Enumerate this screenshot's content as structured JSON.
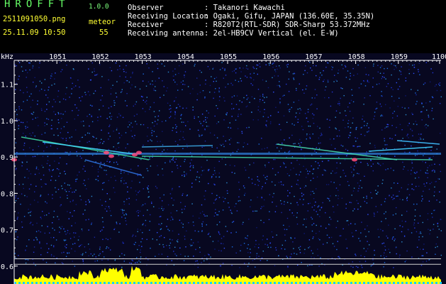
{
  "header": {
    "app_name": "HROFFT",
    "version": "1.0.0",
    "filename": "2511091050.png",
    "datetime": "25.11.09 10:50",
    "meteor_label": "meteor",
    "meteor_count": "55",
    "info_labels": [
      "Observer",
      "Receiving Location",
      "Receiver",
      "Receiving antenna"
    ],
    "info_values": [
      ": Takanori Kawachi",
      ": Ogaki, Gifu, JAPAN (136.60E, 35.35N)",
      ": R820T2(RTL-SDR) SDR-Sharp 53.372MHz",
      ": 2el-HB9CV Vertical (el. E-W)"
    ]
  },
  "chart_data": {
    "type": "heatmap",
    "title": "",
    "x_unit": "minute",
    "y_unit": "kHz",
    "x_ticks": [
      "1051",
      "1052",
      "1053",
      "1054",
      "1055",
      "1056",
      "1057",
      "1058",
      "1059",
      "1100"
    ],
    "y_ticks": [
      "1.1",
      "1.0",
      "0.9",
      "0.8",
      "0.7",
      "0.6"
    ],
    "y_range": [
      0.58,
      1.16
    ],
    "colors": {
      "background": "#0a0a2a",
      "axis": "#ffffff",
      "audio_level": "#ffff00",
      "noise": "#2a3cff"
    }
  }
}
